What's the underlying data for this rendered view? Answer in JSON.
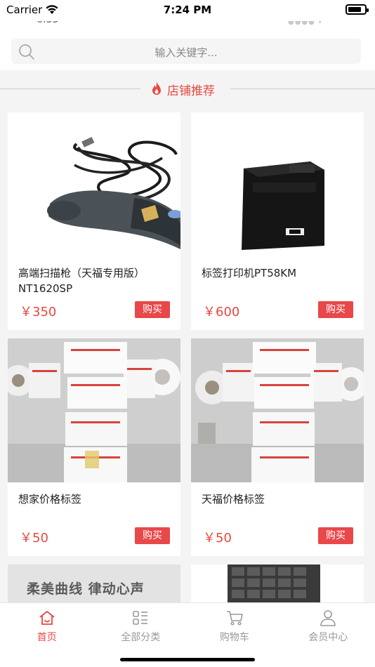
{
  "status_bar": {
    "carrier": "Carrier",
    "time": "7:24 PM",
    "battery_level": 0.8
  },
  "search": {
    "placeholder": "输入关键字..."
  },
  "section": {
    "title": "店铺推荐"
  },
  "products": [
    {
      "name": "高端扫描枪（天福专用版）NT1620SP",
      "price": "￥350",
      "buy_label": "购买"
    },
    {
      "name": "标签打印机PT58KM",
      "price": "￥600",
      "buy_label": "购买"
    },
    {
      "name": "想家价格标签",
      "price": "￥50",
      "buy_label": "购买"
    },
    {
      "name": "天福价格标签",
      "price": "￥50",
      "buy_label": "购买"
    },
    {
      "image_text": "柔美曲线 律动心声"
    }
  ],
  "tabs": [
    {
      "label": "首页",
      "icon": "home-icon",
      "active": true
    },
    {
      "label": "全部分类",
      "icon": "category-icon",
      "active": false
    },
    {
      "label": "购物车",
      "icon": "cart-icon",
      "active": false
    },
    {
      "label": "会员中心",
      "icon": "user-icon",
      "active": false
    }
  ],
  "colors": {
    "accent": "#e8483f",
    "buy_button": "#e8484a",
    "inactive_tab": "#999999"
  }
}
